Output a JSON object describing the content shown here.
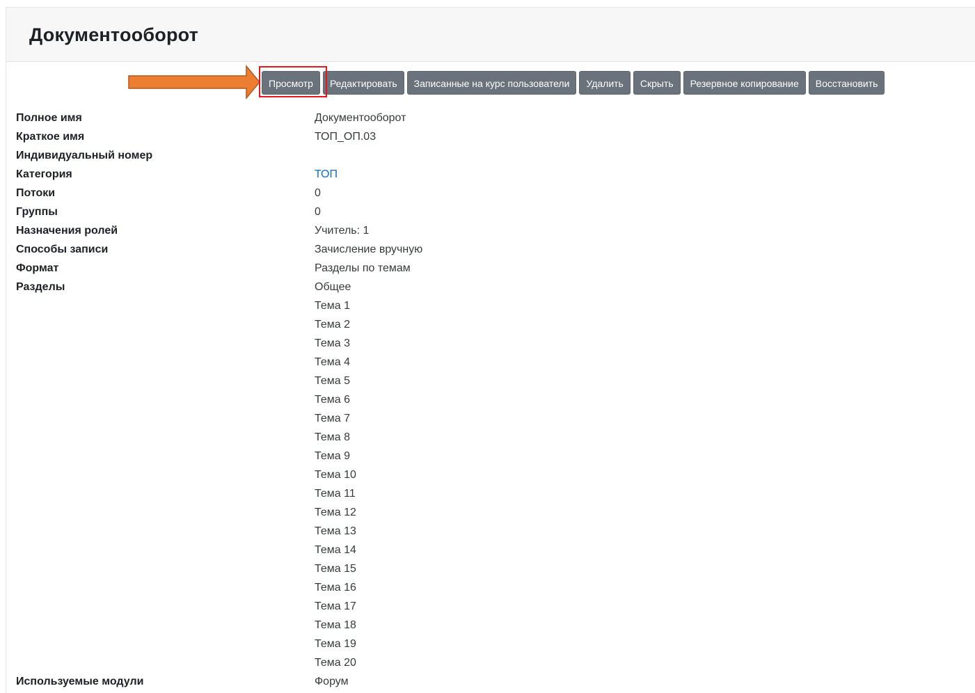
{
  "page": {
    "title": "Документооборот"
  },
  "toolbar": {
    "buttons": [
      {
        "label": "Просмотр"
      },
      {
        "label": "Редактировать"
      },
      {
        "label": "Записанные на курс пользователи"
      },
      {
        "label": "Удалить"
      },
      {
        "label": "Скрыть"
      },
      {
        "label": "Резервное копирование"
      },
      {
        "label": "Восстановить"
      }
    ]
  },
  "info": {
    "full_name": {
      "label": "Полное имя",
      "value": "Документооборот"
    },
    "short_name": {
      "label": "Краткое имя",
      "value": "ТОП_ОП.03"
    },
    "id_number": {
      "label": "Индивидуальный номер",
      "value": ""
    },
    "category": {
      "label": "Категория",
      "value": "ТОП"
    },
    "streams": {
      "label": "Потоки",
      "value": "0"
    },
    "groups": {
      "label": "Группы",
      "value": "0"
    },
    "roles": {
      "label": "Назначения ролей",
      "value": "Учитель: 1"
    },
    "enrol": {
      "label": "Способы записи",
      "value": "Зачисление вручную"
    },
    "format": {
      "label": "Формат",
      "value": "Разделы по темам"
    },
    "sections": {
      "label": "Разделы",
      "items": [
        "Общее",
        "Тема 1",
        "Тема 2",
        "Тема 3",
        "Тема 4",
        "Тема 5",
        "Тема 6",
        "Тема 7",
        "Тема 8",
        "Тема 9",
        "Тема 10",
        "Тема 11",
        "Тема 12",
        "Тема 13",
        "Тема 14",
        "Тема 15",
        "Тема 16",
        "Тема 17",
        "Тема 18",
        "Тема 19",
        "Тема 20"
      ]
    },
    "modules": {
      "label": "Используемые модули",
      "value": "Форум"
    }
  },
  "colors": {
    "button_bg": "#6a737b",
    "highlight": "#e3171c",
    "arrow": "#ed7d31",
    "link": "#0f6cbf"
  },
  "icons": {
    "annotation": "arrow-right-icon"
  }
}
